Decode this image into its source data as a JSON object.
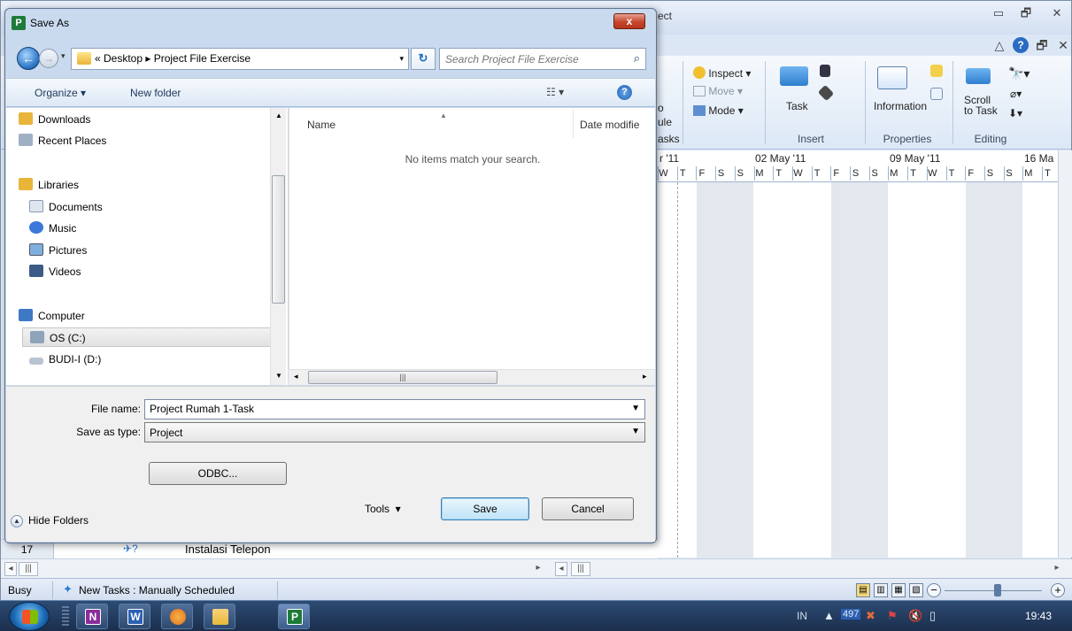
{
  "app": {
    "title_fragment": "ect",
    "ribbon": {
      "inspect_label": "Inspect",
      "move_label": "Move",
      "mode_label": "Mode",
      "frag_o": "o",
      "frag_ule": "ule",
      "frag_asks": "asks",
      "task_label": "Task",
      "information_label": "Information",
      "scroll_label": "Scroll",
      "to_task_label": "to Task",
      "groups": {
        "insert": "Insert",
        "properties": "Properties",
        "editing": "Editing"
      }
    },
    "timeline": {
      "weeks": [
        "r '11",
        "02 May '11",
        "09 May '11",
        "16 Ma"
      ],
      "days": [
        "W",
        "T",
        "F",
        "S",
        "S",
        "M",
        "T",
        "W",
        "T",
        "F",
        "S",
        "S",
        "M",
        "T",
        "W",
        "T",
        "F",
        "S",
        "S",
        "M",
        "T"
      ]
    },
    "task_row": {
      "number": "17",
      "name": "Instalasi Telepon"
    },
    "status": {
      "state": "Busy",
      "mode": "New Tasks : Manually Scheduled"
    }
  },
  "taskbar": {
    "apps": [
      {
        "name": "onenote",
        "letter": "N",
        "color": "#8a2d9b"
      },
      {
        "name": "word",
        "letter": "W",
        "color": "#2b5fb3"
      },
      {
        "name": "firefox",
        "letter": "",
        "color": "#e8711c"
      },
      {
        "name": "explorer",
        "letter": "",
        "color": "#e8b83c"
      },
      {
        "name": "project",
        "letter": "P",
        "color": "#1e7b3a"
      }
    ],
    "language": "IN",
    "tray_count": "497",
    "clock": "19:43"
  },
  "dialog": {
    "title": "Save As",
    "close_glyph": "x",
    "address_path": "« Desktop  ▸  Project File Exercise",
    "search_placeholder": "Search Project File Exercise",
    "organize_label": "Organize ▾",
    "new_folder_label": "New folder",
    "nav_items": [
      {
        "label": "Downloads",
        "icon": "downloads-icon",
        "color": "#e9b43a"
      },
      {
        "label": "Recent Places",
        "icon": "recent-places-icon",
        "color": "#9fb0c4"
      },
      {
        "label": "Libraries",
        "icon": "libraries-icon",
        "color": "#e9b43a"
      },
      {
        "label": "Documents",
        "icon": "documents-icon",
        "color": "#dfe6ef"
      },
      {
        "label": "Music",
        "icon": "music-icon",
        "color": "#3b78d8"
      },
      {
        "label": "Pictures",
        "icon": "pictures-icon",
        "color": "#7fb0dd"
      },
      {
        "label": "Videos",
        "icon": "videos-icon",
        "color": "#3c5b86"
      },
      {
        "label": "Computer",
        "icon": "computer-icon",
        "color": "#3f79c6"
      },
      {
        "label": "OS (C:)",
        "icon": "drive-c-icon",
        "color": "#8fa3bb"
      },
      {
        "label": "BUDI-I (D:)",
        "icon": "drive-d-icon",
        "color": "#b9c4d1"
      }
    ],
    "columns": {
      "name": "Name",
      "date": "Date modifie"
    },
    "empty_message": "No items match your search.",
    "file_name_label": "File name:",
    "file_name_value": "Project Rumah 1-Task",
    "save_type_label": "Save as type:",
    "save_type_value": "Project",
    "odbc_label": "ODBC...",
    "hide_folders_label": "Hide Folders",
    "tools_label": "Tools",
    "save_label": "Save",
    "cancel_label": "Cancel"
  }
}
